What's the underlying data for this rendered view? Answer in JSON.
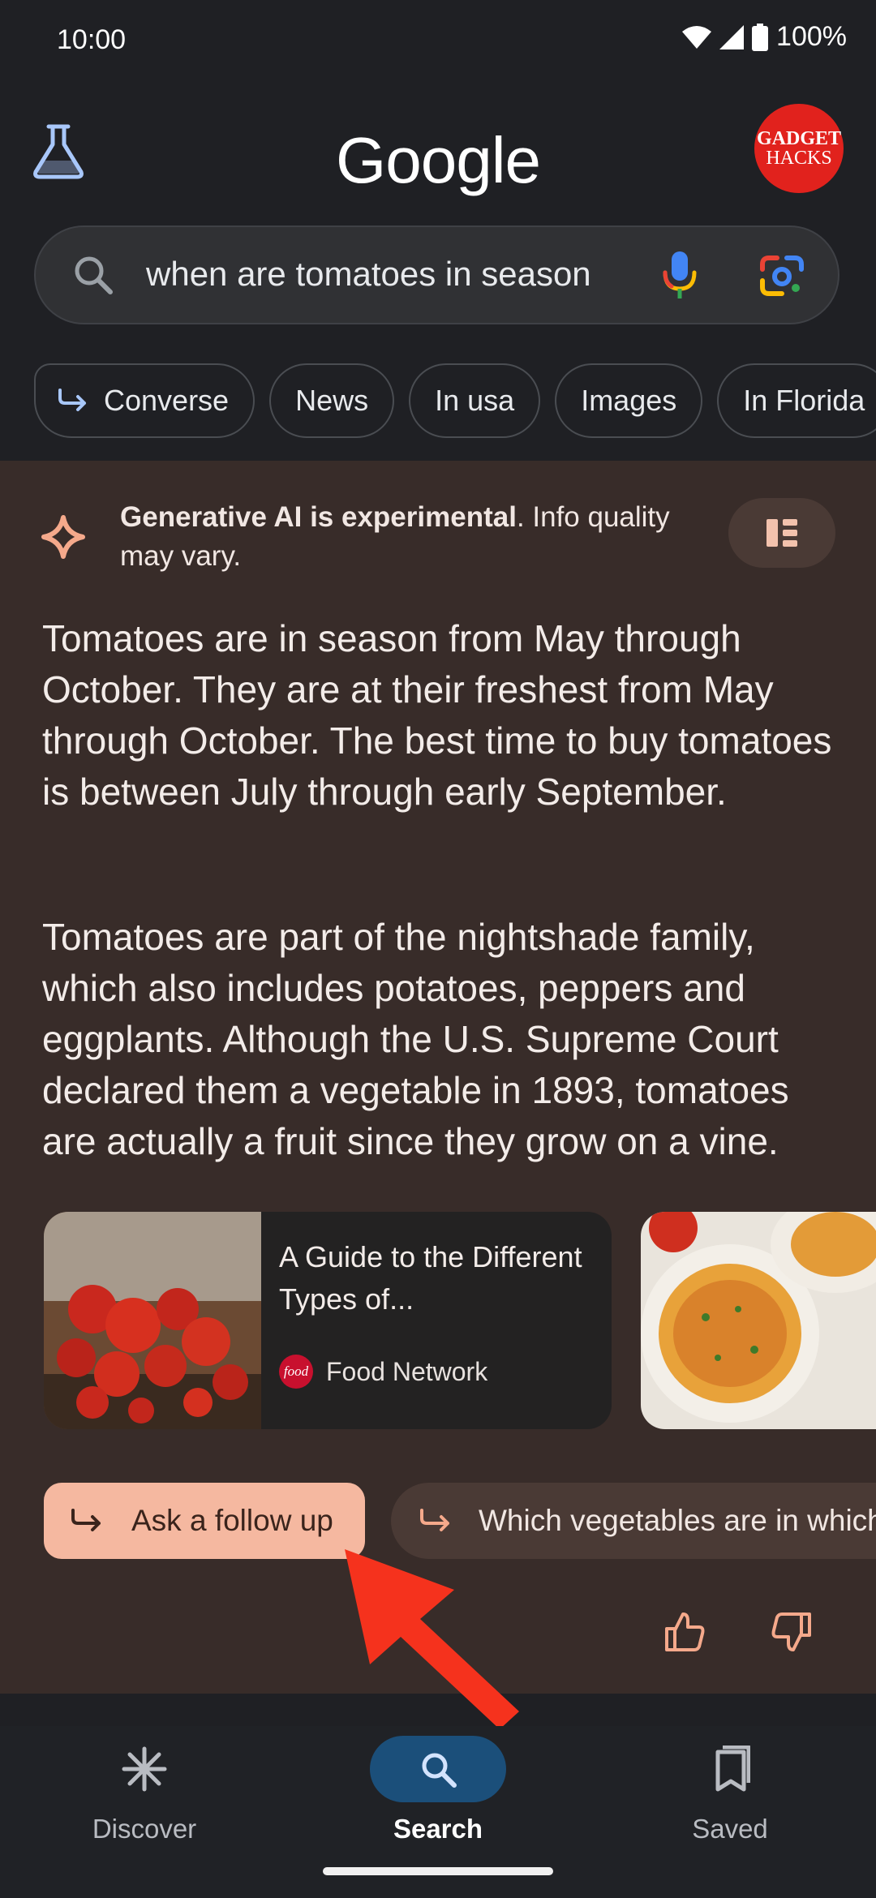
{
  "status_bar": {
    "time": "10:00",
    "battery": "100%"
  },
  "header": {
    "logo": "Google",
    "avatar": {
      "line1": "GADGET",
      "line2": "HACKS"
    }
  },
  "search": {
    "query": "when are tomatoes in season"
  },
  "chips": [
    "Converse",
    "News",
    "In usa",
    "Images",
    "In Florida"
  ],
  "ai_overview": {
    "disclaimer_bold": "Generative AI is experimental",
    "disclaimer_rest": ". Info quality may vary.",
    "paragraph1": "Tomatoes are in season from May through October. They are at their freshest from May through October. The best time to buy tomatoes is between July through early September.",
    "paragraph2": "Tomatoes are part of the nightshade family, which also includes potatoes, peppers and eggplants. Although the U.S. Supreme Court declared them a vegetable in 1893, tomatoes are actually a fruit since they grow on a vine.",
    "source_card": {
      "title": "A Guide to the Different Types of...",
      "source": "Food Network",
      "source_logo_text": "food"
    },
    "followup_label": "Ask a follow up",
    "suggestion_label": "Which vegetables are in which"
  },
  "bottom_nav": {
    "discover": "Discover",
    "search": "Search",
    "saved": "Saved"
  },
  "colors": {
    "background": "#1f2024",
    "card_background": "#382c29",
    "followup_accent": "#f5b8a0",
    "annotation_arrow": "#f5321d",
    "nav_active_pill": "#1b4f7a"
  }
}
